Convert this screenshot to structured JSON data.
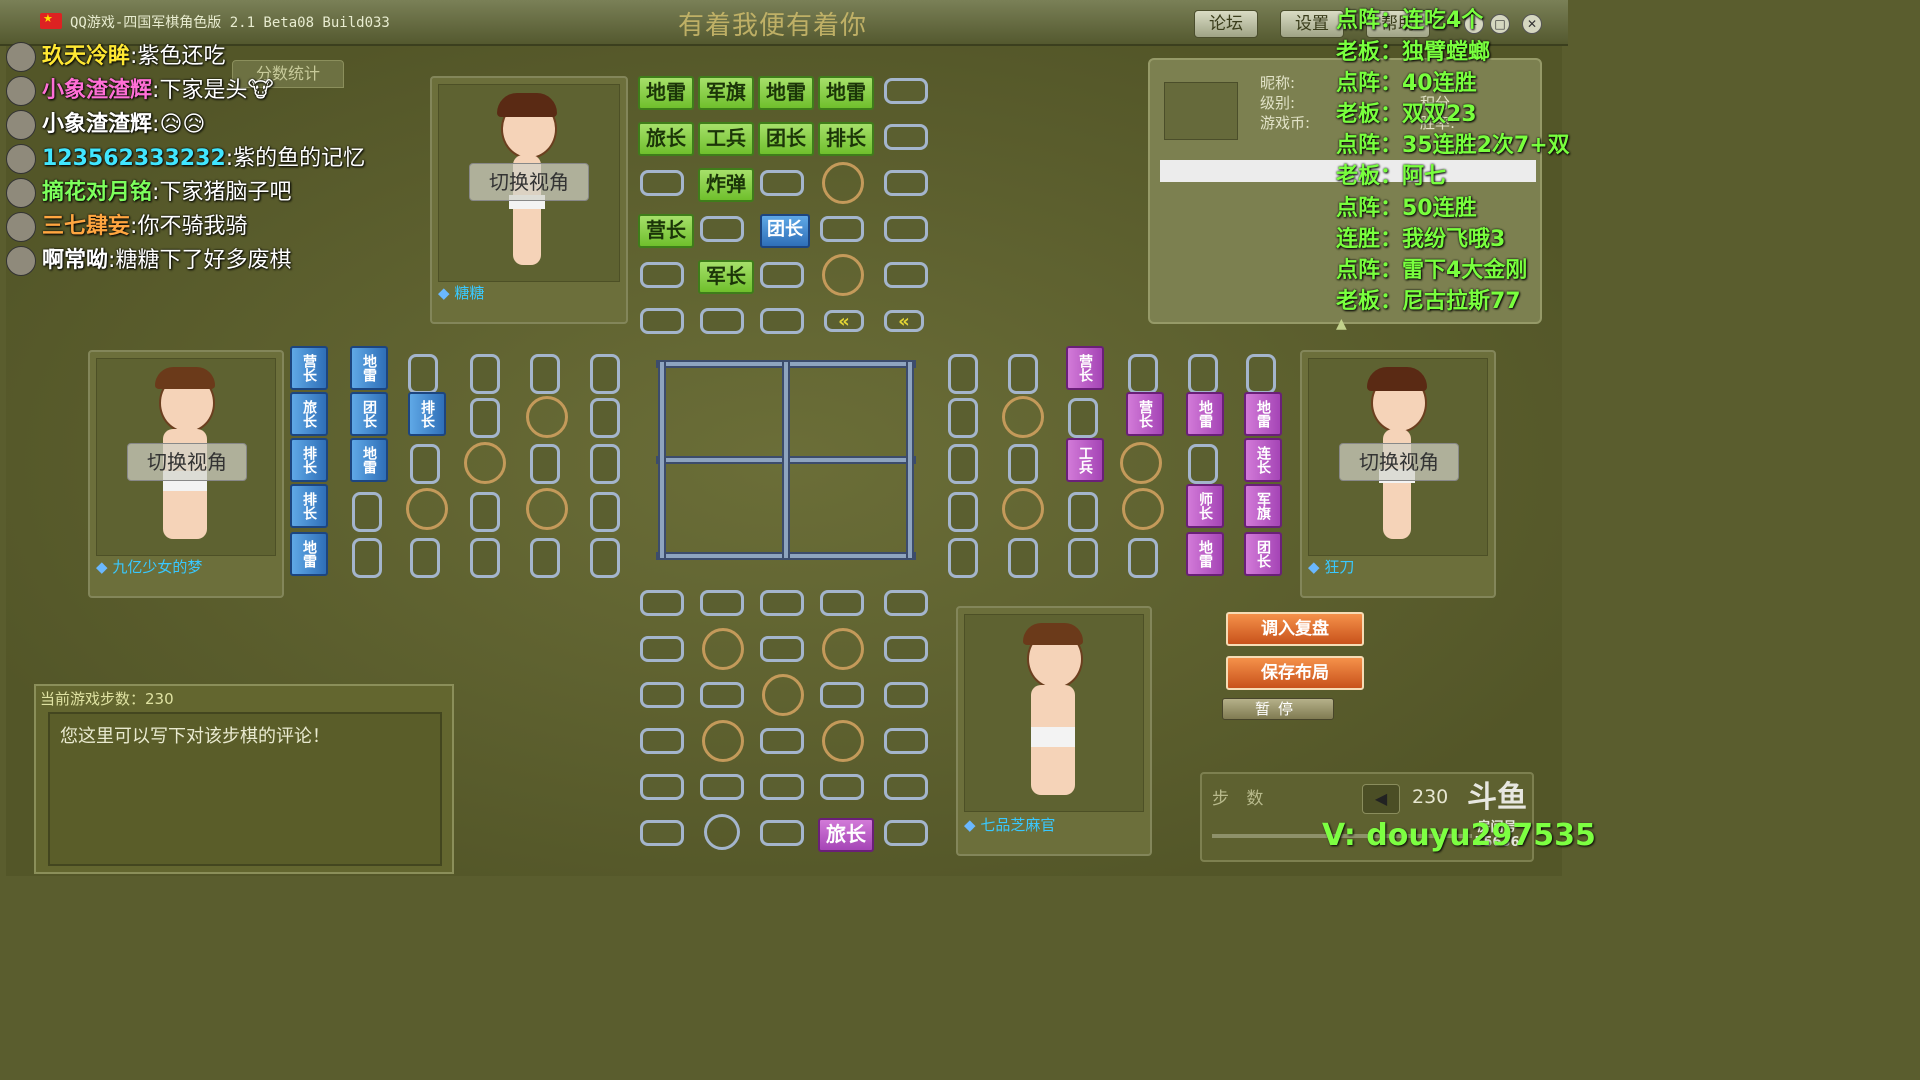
{
  "window": {
    "title": "QQ游戏-四国军棋角色版 2.1 Beta08 Build033",
    "banner": "有着我便有着你",
    "buttons": {
      "forum": "论坛",
      "settings": "设置",
      "help": "帮助"
    }
  },
  "chat": [
    {
      "name": "玖天冷眸",
      "msg": "紫色还吃",
      "color": "#ffe833"
    },
    {
      "name": "小象渣渣辉",
      "msg": "下家是头🐮",
      "color": "#ff6fd6"
    },
    {
      "name": "小象渣渣辉",
      "msg": "😥😥",
      "color": "#ffffff"
    },
    {
      "name": "123562333232",
      "msg": "紫的鱼的记忆",
      "color": "#41e6ff"
    },
    {
      "name": "摘花对月铭",
      "msg": "下家猪脑子吧",
      "color": "#7dff5c"
    },
    {
      "name": "三七肆妄",
      "msg": "你不骑我骑",
      "color": "#ffa640"
    },
    {
      "name": "啊常呦",
      "msg": "糖糖下了好多废棋",
      "color": "#ffffff"
    }
  ],
  "score_tab": "分数统计",
  "players": {
    "top": {
      "name": "糖糖",
      "view_button": "切换视角"
    },
    "left": {
      "name": "九亿少女的梦",
      "view_button": "切换视角"
    },
    "right": {
      "name": "狂刀",
      "view_button": "切换视角"
    },
    "bottom": {
      "name": "七品芝麻官"
    }
  },
  "board": {
    "top_pieces": [
      "地雷",
      "军旗",
      "地雷",
      "地雷",
      "旅长",
      "工兵",
      "团长",
      "排长",
      "炸弹",
      "营长",
      "团长",
      "军长"
    ],
    "bottom_pieces": [
      "旅长"
    ],
    "left_pieces": [
      "营长",
      "旅长",
      "排长",
      "排长",
      "地雷",
      "地雷",
      "团长",
      "团长",
      "地雷",
      "排长"
    ],
    "right_pieces": [
      "营长",
      "营长",
      "地雷",
      "地雷",
      "工兵",
      "连长",
      "师长",
      "军旗",
      "地雷",
      "团长"
    ]
  },
  "info_panel": {
    "nickname_label": "昵称:",
    "level_label": "级别:",
    "coins_label": "游戏币:",
    "score_label": "积分",
    "wins_label": "胜率:"
  },
  "announcements": [
    "点阵：连吃4个",
    "老板：独臂螳螂",
    "点阵：40连胜",
    "老板：双双23",
    "点阵：35连胜2次7+双",
    "老板：阿七",
    "点阵：50连胜",
    "连胜：我纷飞哦3",
    "点阵：雷下4大金刚",
    "老板：尼古拉斯77"
  ],
  "game": {
    "step_label": "当前游戏步数：",
    "step_value": "230",
    "comment_placeholder": "您这里可以写下对该步棋的评论！",
    "load_replay": "调入复盘",
    "save_layout": "保存布局",
    "pause": "暂停",
    "steps_label": "步 数",
    "steps_value": "230"
  },
  "overlay": {
    "douyu_logo": "斗鱼",
    "room_label": "房间号",
    "room_number": "55636",
    "watermark": "V: douyu297535"
  }
}
